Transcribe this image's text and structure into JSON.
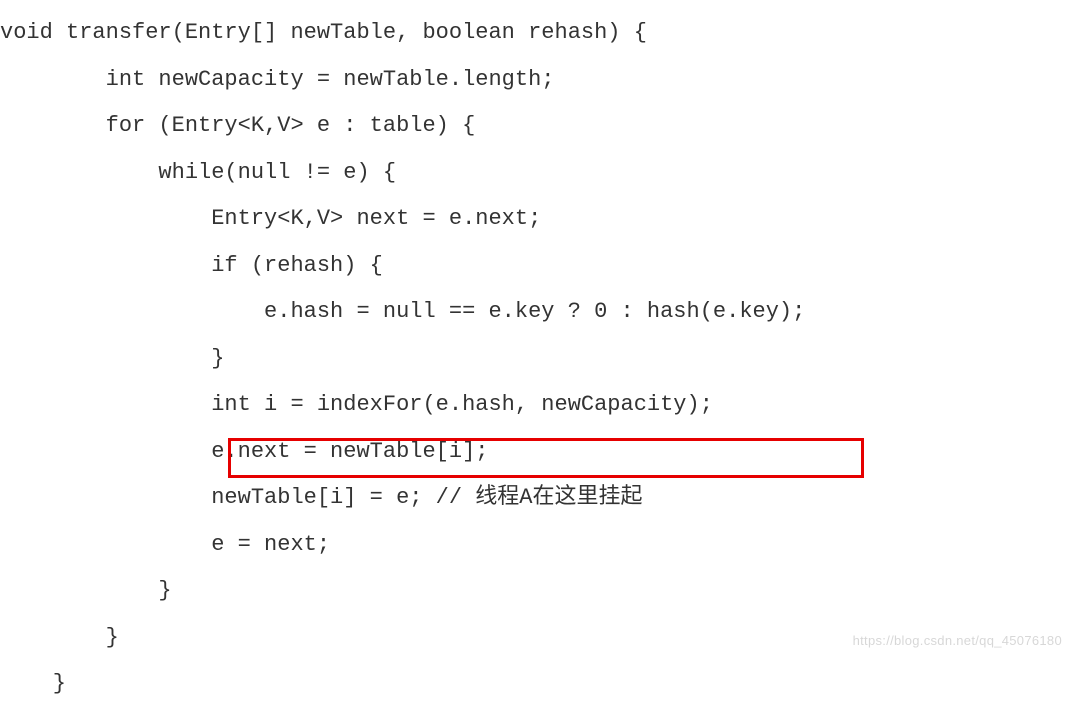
{
  "code": {
    "line1": "void transfer(Entry[] newTable, boolean rehash) {",
    "line2": "        int newCapacity = newTable.length;",
    "line3": "        for (Entry<K,V> e : table) {",
    "line4": "            while(null != e) {",
    "line5": "                Entry<K,V> next = e.next;",
    "line6": "                if (rehash) {",
    "line7": "                    e.hash = null == e.key ? 0 : hash(e.key);",
    "line8": "                }",
    "line9": "                int i = indexFor(e.hash, newCapacity);",
    "line10": "                e.next = newTable[i];",
    "line11": "                newTable[i] = e; // 线程A在这里挂起",
    "line12": "                e = next;",
    "line13": "            }",
    "line14": "        }",
    "line15": "    }"
  },
  "watermark": "https://blog.csdn.net/qq_45076180"
}
